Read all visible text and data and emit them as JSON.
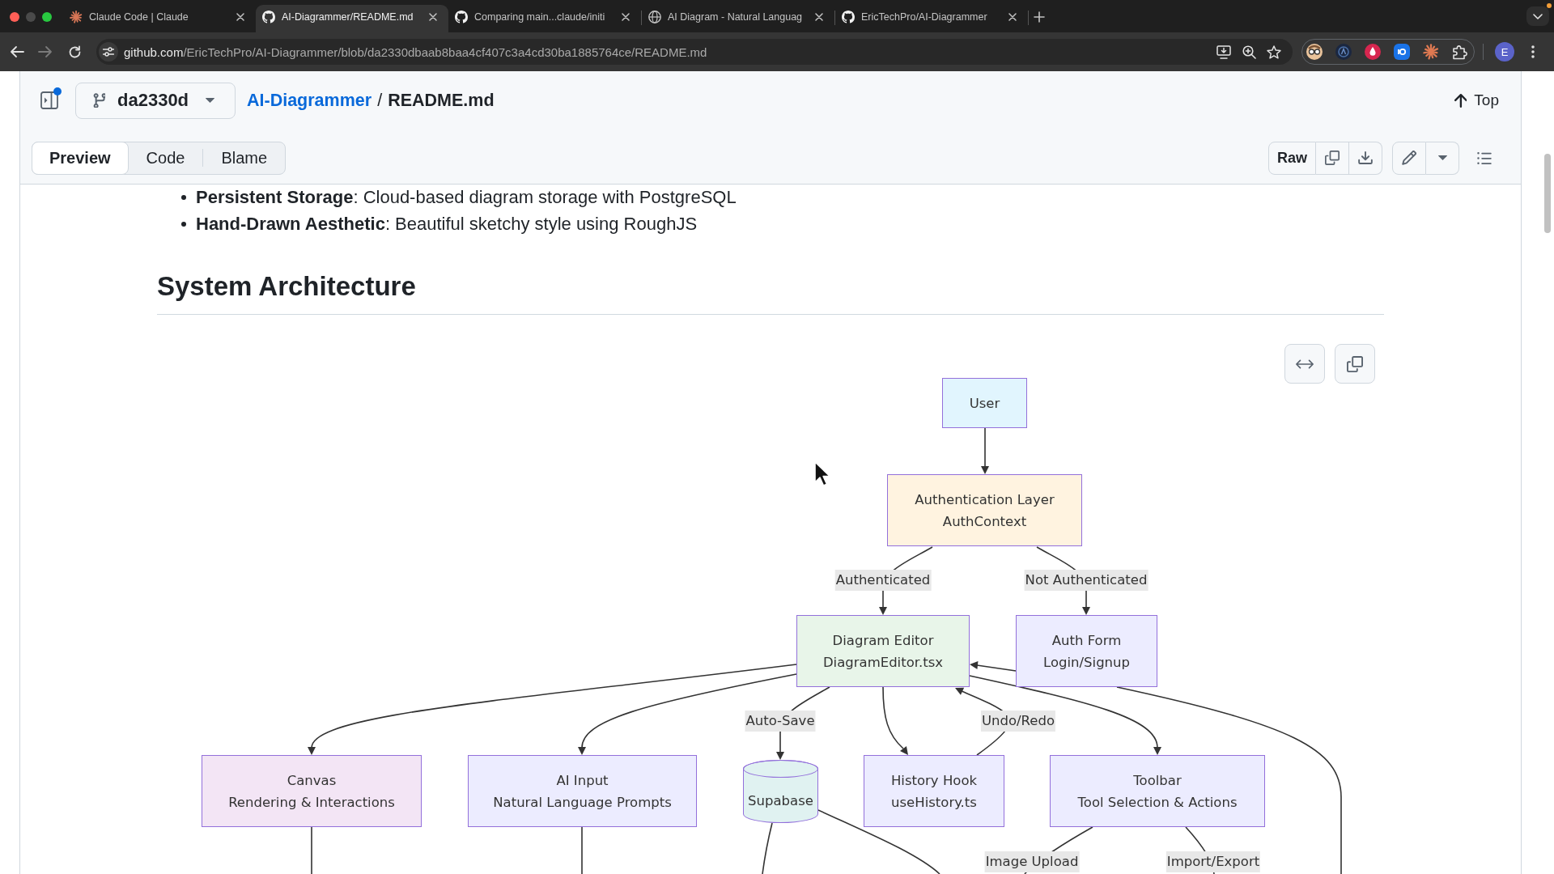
{
  "browser": {
    "tabs": [
      {
        "kind": "claude",
        "title": "Claude Code | Claude",
        "selected": false
      },
      {
        "kind": "github",
        "title": "AI-Diagrammer/README.md",
        "selected": true
      },
      {
        "kind": "github",
        "title": "Comparing main...claude/initi",
        "selected": false
      },
      {
        "kind": "site",
        "title": "AI Diagram - Natural Languag",
        "selected": false
      },
      {
        "kind": "github",
        "title": "EricTechPro/AI-Diagrammer",
        "selected": false
      }
    ],
    "forward_disabled": true,
    "address": {
      "host": "github.com",
      "path": "/EricTechPro/AI-Diagrammer/blob/da2330dbaab8baa4cf407c3a4cd30ba1885764ce/README.md"
    },
    "profile": {
      "initial": "E"
    }
  },
  "file_header": {
    "branch": "da2330d",
    "repo": "AI-Diagrammer",
    "separator": "/",
    "file": "README.md",
    "top": "Top"
  },
  "view_tabs": [
    {
      "label": "Preview",
      "selected": true
    },
    {
      "label": "Code",
      "selected": false
    },
    {
      "label": "Blame",
      "selected": false
    }
  ],
  "file_actions": {
    "raw": "Raw"
  },
  "readme": {
    "list": [
      "**Persistent Storage**: Cloud-based diagram storage with PostgreSQL",
      "**Hand-Drawn Aesthetic**: Beautiful sketchy style using RoughJS"
    ],
    "heading": "System Architecture",
    "diagram": {
      "nodes": [
        {
          "kind": "process",
          "lines": [
            "User"
          ],
          "color": "#e1f5fe"
        },
        {
          "kind": "process",
          "lines": [
            "Authentication Layer",
            "AuthContext"
          ],
          "color": "#fff3e0"
        },
        {
          "kind": "process",
          "lines": [
            "Diagram Editor",
            "DiagramEditor.tsx"
          ],
          "color": "#e8f5e9"
        },
        {
          "kind": "process",
          "lines": [
            "Auth Form",
            "Login/Signup"
          ],
          "color": "#ececff"
        },
        {
          "kind": "process",
          "lines": [
            "Canvas",
            "Rendering & Interactions"
          ],
          "color": "#f3e5f5"
        },
        {
          "kind": "process",
          "lines": [
            "AI Input",
            "Natural Language Prompts"
          ],
          "color": "#ececff"
        },
        {
          "kind": "database",
          "lines": [
            "Supabase"
          ],
          "color": "#e0f2f1"
        },
        {
          "kind": "process",
          "lines": [
            "History Hook",
            "useHistory.ts"
          ],
          "color": "#ececff"
        },
        {
          "kind": "process",
          "lines": [
            "Toolbar",
            "Tool Selection & Actions"
          ],
          "color": "#ececff"
        }
      ],
      "edge_labels": [
        "Authenticated",
        "Not Authenticated",
        "Auto-Save",
        "Undo/Redo",
        "Image Upload",
        "Import/Export"
      ]
    }
  }
}
